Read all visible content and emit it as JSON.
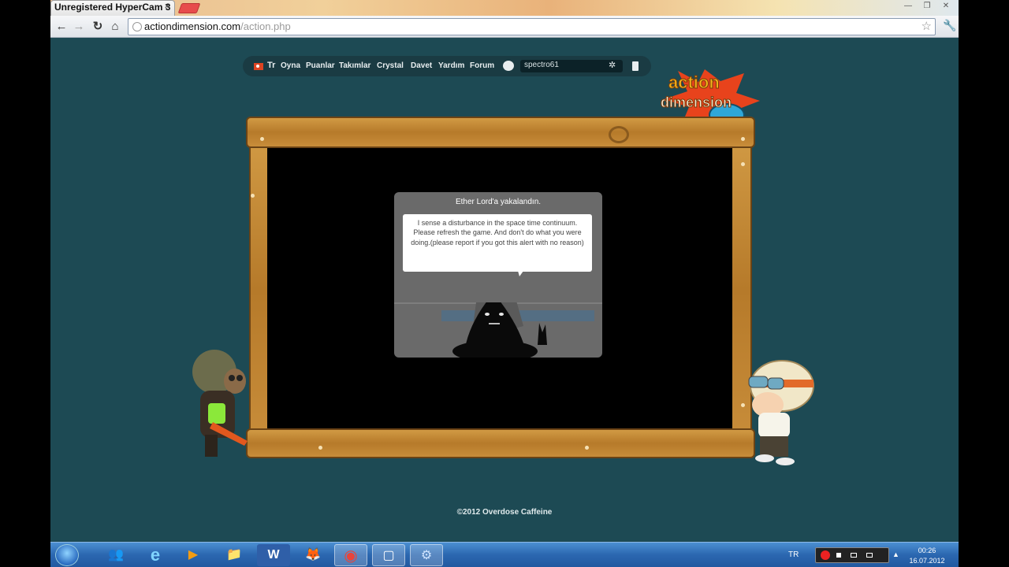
{
  "browser": {
    "tab_title": "Unregistered HyperCam 3",
    "tab_close": "×",
    "window_min": "—",
    "window_max": "❐",
    "window_close": "✕",
    "back": "←",
    "forward": "→",
    "reload": "↻",
    "home": "⌂",
    "url_host": "actiondimension.com",
    "url_path": "/action.php",
    "star": "☆",
    "wrench": "🔧"
  },
  "game_nav": {
    "language": "Tr",
    "items": [
      "Oyna",
      "Puanlar",
      "Takımlar",
      "Crystal",
      "Davet",
      "Yardım",
      "Forum"
    ],
    "username": "spectro61",
    "gear": "✲"
  },
  "logo": {
    "line1": "action",
    "line2": "dimension"
  },
  "dialog": {
    "title": "Ether Lord'a yakalandın.",
    "message": "I sense a disturbance in the space time continuum. Please refresh the game. And don't do what you were doing.(please report if you got this alert with no reason)"
  },
  "footer": {
    "copyright": "©2012 Overdose Caffeine"
  },
  "taskbar": {
    "tray_language": "TR",
    "tray_up": "▲",
    "time": "00:26",
    "date": "16.07.2012",
    "apps": [
      {
        "name": "people",
        "glyph": "👥"
      },
      {
        "name": "internet-explorer",
        "glyph": "e"
      },
      {
        "name": "media-player",
        "glyph": "▶"
      },
      {
        "name": "folder",
        "glyph": "📁"
      },
      {
        "name": "word",
        "glyph": "W"
      },
      {
        "name": "firefox",
        "glyph": "🦊"
      },
      {
        "name": "chrome",
        "glyph": "◉"
      },
      {
        "name": "app-window",
        "glyph": "▢"
      },
      {
        "name": "hypercam",
        "glyph": "⚙"
      }
    ]
  },
  "colors": {
    "page_background": "#1d4a54",
    "frame_wood": "#c88d3a",
    "taskbar": "#2b67b0"
  }
}
